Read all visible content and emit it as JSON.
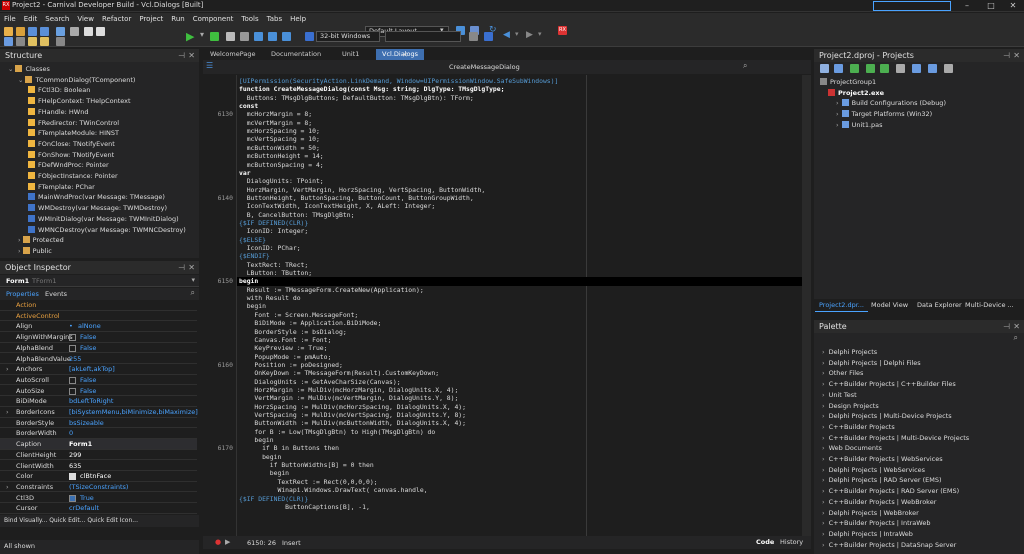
{
  "window": {
    "title": "Project2 - Carnival Developer Build - Vcl.Dialogs [Built]",
    "logo": "RX"
  },
  "menu": [
    "File",
    "Edit",
    "Search",
    "View",
    "Refactor",
    "Project",
    "Run",
    "Component",
    "Tools",
    "Tabs",
    "Help"
  ],
  "toolbar": {
    "layout": "Default Layout",
    "platform": "32-bit Windows"
  },
  "structure": {
    "title": "Structure",
    "items": [
      {
        "label": "Classes",
        "icon": "folder",
        "level": 0
      },
      {
        "label": "TCommonDialog(TComponent)",
        "icon": "folder",
        "level": 1
      },
      {
        "label": "FCtl3D: Boolean",
        "icon": "prop",
        "level": 2
      },
      {
        "label": "FHelpContext: THelpContext",
        "icon": "prop",
        "level": 2
      },
      {
        "label": "FHandle: HWnd",
        "icon": "prop",
        "level": 2
      },
      {
        "label": "FRedirector: TWinControl",
        "icon": "prop",
        "level": 2
      },
      {
        "label": "FTemplateModule: HINST",
        "icon": "prop",
        "level": 2
      },
      {
        "label": "FOnClose: TNotifyEvent",
        "icon": "prop",
        "level": 2
      },
      {
        "label": "FOnShow: TNotifyEvent",
        "icon": "prop",
        "level": 2
      },
      {
        "label": "FDefWndProc: Pointer",
        "icon": "prop",
        "level": 2
      },
      {
        "label": "FObjectInstance: Pointer",
        "icon": "prop",
        "level": 2
      },
      {
        "label": "FTemplate: PChar",
        "icon": "prop",
        "level": 2
      },
      {
        "label": "MainWndProc(var Message: TMessage)",
        "icon": "meth",
        "level": 2
      },
      {
        "label": "WMDestroy(var Message: TWMDestroy)",
        "icon": "meth",
        "level": 2
      },
      {
        "label": "WMInitDialog(var Message: TWMInitDialog)",
        "icon": "meth",
        "level": 2
      },
      {
        "label": "WMNCDestroy(var Message: TWMNCDestroy)",
        "icon": "meth",
        "level": 2
      },
      {
        "label": "Protected",
        "icon": "folder",
        "level": 1
      },
      {
        "label": "Public",
        "icon": "folder",
        "level": 1
      }
    ]
  },
  "object_inspector": {
    "title": "Object Inspector",
    "selected": "Form1",
    "selected_type": "TForm1",
    "tabs": [
      "Properties",
      "Events"
    ],
    "rows": [
      {
        "k": "Action",
        "v": "",
        "cat": true
      },
      {
        "k": "ActiveControl",
        "v": "",
        "cat": true
      },
      {
        "k": "Align",
        "v": "alNone"
      },
      {
        "k": "AlignWithMargins",
        "v": "False"
      },
      {
        "k": "AlphaBlend",
        "v": "False"
      },
      {
        "k": "AlphaBlendValue",
        "v": "255"
      },
      {
        "k": "Anchors",
        "v": "[akLeft,akTop]",
        "exp": true
      },
      {
        "k": "AutoScroll",
        "v": "False"
      },
      {
        "k": "AutoSize",
        "v": "False"
      },
      {
        "k": "BiDiMode",
        "v": "bdLeftToRight"
      },
      {
        "k": "BorderIcons",
        "v": "[biSystemMenu,biMinimize,biMaximize]",
        "exp": true
      },
      {
        "k": "BorderStyle",
        "v": "bsSizeable"
      },
      {
        "k": "BorderWidth",
        "v": "0"
      },
      {
        "k": "Caption",
        "v": "Form1",
        "sel": true
      },
      {
        "k": "ClientHeight",
        "v": "299",
        "w": true
      },
      {
        "k": "ClientWidth",
        "v": "635",
        "w": true
      },
      {
        "k": "Color",
        "v": "clBtnFace",
        "w": true
      },
      {
        "k": "Constraints",
        "v": "(TSizeConstraints)",
        "exp": true
      },
      {
        "k": "Ctl3D",
        "v": "True"
      },
      {
        "k": "Cursor",
        "v": "crDefault"
      }
    ],
    "footer_links": "Bind Visually...  Quick Edit...  Quick Edit Icon...",
    "footer_status": "All shown"
  },
  "editor": {
    "tabs": [
      "WelcomePage",
      "Documentation",
      "Unit1",
      "Vcl.Dialogs"
    ],
    "active_tab": "Vcl.Dialogs",
    "method": "CreateMessageDialog",
    "cursor": "6150: 26",
    "mode": "Insert",
    "bottom_tabs": [
      "Code",
      "History"
    ],
    "lines": [
      {
        "n": "",
        "t": "[UIPermission(SecurityAction.LinkDemand, Window=UIPermissionWindow.SafeSubWindows)]",
        "c": "dir"
      },
      {
        "n": "",
        "t": "function CreateMessageDialog(const Msg: string; DlgType: TMsgDlgType;",
        "c": "kw"
      },
      {
        "n": "",
        "t": "  Buttons: TMsgDlgButtons; DefaultButton: TMsgDlgBtn): TForm;"
      },
      {
        "n": "",
        "t": "const",
        "c": "kw"
      },
      {
        "n": "6130",
        "t": "  mcHorzMargin = 8;"
      },
      {
        "n": "",
        "t": "  mcVertMargin = 8;"
      },
      {
        "n": "",
        "t": "  mcHorzSpacing = 10;"
      },
      {
        "n": "",
        "t": "  mcVertSpacing = 10;"
      },
      {
        "n": "",
        "t": "  mcButtonWidth = 50;"
      },
      {
        "n": "",
        "t": "  mcButtonHeight = 14;"
      },
      {
        "n": "",
        "t": "  mcButtonSpacing = 4;"
      },
      {
        "n": "",
        "t": "var",
        "c": "kw"
      },
      {
        "n": "",
        "t": "  DialogUnits: TPoint;"
      },
      {
        "n": "",
        "t": "  HorzMargin, VertMargin, HorzSpacing, VertSpacing, ButtonWidth,"
      },
      {
        "n": "6140",
        "t": "  ButtonHeight, ButtonSpacing, ButtonCount, ButtonGroupWidth,"
      },
      {
        "n": "",
        "t": "  IconTextWidth, IconTextHeight, X, ALeft: Integer;"
      },
      {
        "n": "",
        "t": "  B, CancelButton: TMsgDlgBtn;"
      },
      {
        "n": "",
        "t": "{$IF DEFINED(CLR)}",
        "c": "dir"
      },
      {
        "n": "",
        "t": "  IconID: Integer;"
      },
      {
        "n": "",
        "t": "{$ELSE}",
        "c": "dir"
      },
      {
        "n": "",
        "t": "  IconID: PChar;"
      },
      {
        "n": "",
        "t": "{$ENDIF}",
        "c": "dir"
      },
      {
        "n": "",
        "t": "  TextRect: TRect;"
      },
      {
        "n": "",
        "t": "  LButton: TButton;"
      },
      {
        "n": "6150",
        "t": "begin",
        "c": "kw",
        "cur": true
      },
      {
        "n": "",
        "t": "  Result := TMessageForm.CreateNew(Application);"
      },
      {
        "n": "",
        "t": "  with Result do"
      },
      {
        "n": "",
        "t": "  begin"
      },
      {
        "n": "",
        "t": "    Font := Screen.MessageFont;"
      },
      {
        "n": "",
        "t": "    BiDiMode := Application.BiDiMode;"
      },
      {
        "n": "",
        "t": "    BorderStyle := bsDialog;"
      },
      {
        "n": "",
        "t": "    Canvas.Font := Font;"
      },
      {
        "n": "",
        "t": "    KeyPreview := True;"
      },
      {
        "n": "",
        "t": "    PopupMode := pmAuto;"
      },
      {
        "n": "6160",
        "t": "    Position := poDesigned;"
      },
      {
        "n": "",
        "t": "    OnKeyDown := TMessageForm(Result).CustomKeyDown;"
      },
      {
        "n": "",
        "t": "    DialogUnits := GetAveCharSize(Canvas);"
      },
      {
        "n": "",
        "t": "    HorzMargin := MulDiv(mcHorzMargin, DialogUnits.X, 4);"
      },
      {
        "n": "",
        "t": "    VertMargin := MulDiv(mcVertMargin, DialogUnits.Y, 8);"
      },
      {
        "n": "",
        "t": "    HorzSpacing := MulDiv(mcHorzSpacing, DialogUnits.X, 4);"
      },
      {
        "n": "",
        "t": "    VertSpacing := MulDiv(mcVertSpacing, DialogUnits.Y, 8);"
      },
      {
        "n": "",
        "t": "    ButtonWidth := MulDiv(mcButtonWidth, DialogUnits.X, 4);"
      },
      {
        "n": "",
        "t": "    for B := Low(TMsgDlgBtn) to High(TMsgDlgBtn) do"
      },
      {
        "n": "",
        "t": "    begin"
      },
      {
        "n": "6170",
        "t": "      if B in Buttons then"
      },
      {
        "n": "",
        "t": "      begin"
      },
      {
        "n": "",
        "t": "        if ButtonWidths[B] = 0 then"
      },
      {
        "n": "",
        "t": "        begin"
      },
      {
        "n": "",
        "t": "          TextRect := Rect(0,0,0,0);"
      },
      {
        "n": "",
        "t": "          Winapi.Windows.DrawText( canvas.handle,"
      },
      {
        "n": "",
        "t": "{$IF DEFINED(CLR)}",
        "c": "dir"
      },
      {
        "n": "",
        "t": "            ButtonCaptions[B], -1,"
      }
    ]
  },
  "projects": {
    "title": "Project2.dproj - Projects",
    "items": [
      {
        "label": "ProjectGroup1",
        "level": 0
      },
      {
        "label": "Project2.exe",
        "level": 1,
        "bold": true
      },
      {
        "label": "Build Configurations (Debug)",
        "level": 2
      },
      {
        "label": "Target Platforms (Win32)",
        "level": 2
      },
      {
        "label": "Unit1.pas",
        "level": 2
      }
    ],
    "tabs": [
      "Project2.dpr...",
      "Model View",
      "Data Explorer",
      "Multi-Device ..."
    ]
  },
  "palette": {
    "title": "Palette",
    "items": [
      "Delphi Projects",
      "Delphi Projects | Delphi Files",
      "Other Files",
      "C++Builder Projects | C++Builder Files",
      "Unit Test",
      "Design Projects",
      "Delphi Projects | Multi-Device Projects",
      "C++Builder Projects",
      "C++Builder Projects | Multi-Device Projects",
      "Web Documents",
      "C++Builder Projects | WebServices",
      "Delphi Projects | WebServices",
      "Delphi Projects | RAD Server (EMS)",
      "C++Builder Projects | RAD Server (EMS)",
      "C++Builder Projects | WebBroker",
      "Delphi Projects | WebBroker",
      "C++Builder Projects | IntraWeb",
      "Delphi Projects | IntraWeb",
      "C++Builder Projects | DataSnap Server"
    ]
  },
  "colors": {
    "accent": "#007acc",
    "tab_active": "#3e6fb0"
  }
}
